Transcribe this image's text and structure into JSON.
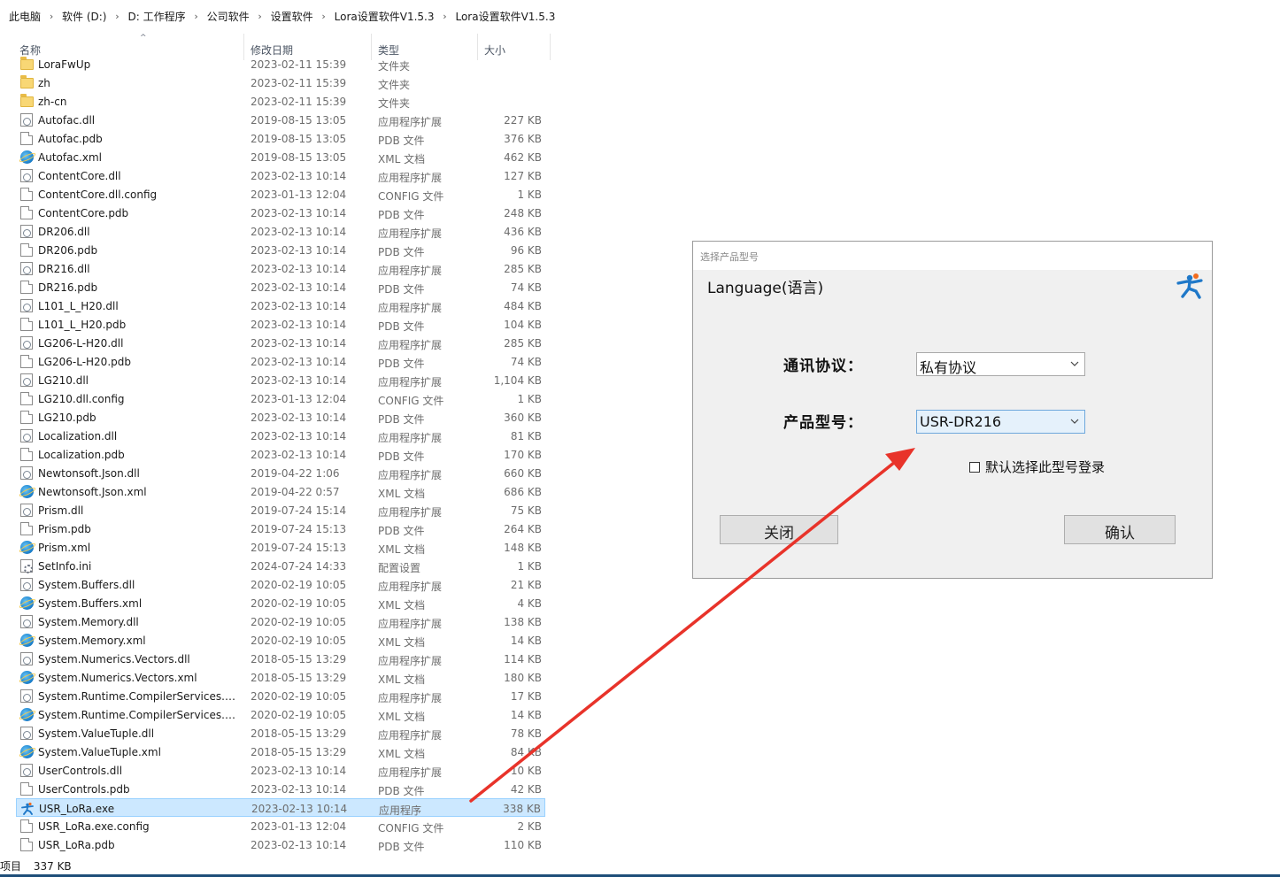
{
  "breadcrumb": [
    "此电脑",
    "软件 (D:)",
    "D:  工作程序",
    "公司软件",
    "设置软件",
    "Lora设置软件V1.5.3",
    "Lora设置软件V1.5.3"
  ],
  "columns": {
    "name": "名称",
    "date": "修改日期",
    "type": "类型",
    "size": "大小"
  },
  "files": [
    {
      "name": "LoraFwUp",
      "date": "2023-02-11 15:39",
      "type": "文件夹",
      "size": "",
      "icon": "folder-icon"
    },
    {
      "name": "zh",
      "date": "2023-02-11 15:39",
      "type": "文件夹",
      "size": "",
      "icon": "folder-icon"
    },
    {
      "name": "zh-cn",
      "date": "2023-02-11 15:39",
      "type": "文件夹",
      "size": "",
      "icon": "folder-icon"
    },
    {
      "name": "Autofac.dll",
      "date": "2019-08-15 13:05",
      "type": "应用程序扩展",
      "size": "227 KB",
      "icon": "dll-file-icon"
    },
    {
      "name": "Autofac.pdb",
      "date": "2019-08-15 13:05",
      "type": "PDB 文件",
      "size": "376 KB",
      "icon": "document-icon"
    },
    {
      "name": "Autofac.xml",
      "date": "2019-08-15 13:05",
      "type": "XML 文档",
      "size": "462 KB",
      "icon": "xml-file-icon"
    },
    {
      "name": "ContentCore.dll",
      "date": "2023-02-13 10:14",
      "type": "应用程序扩展",
      "size": "127 KB",
      "icon": "dll-file-icon"
    },
    {
      "name": "ContentCore.dll.config",
      "date": "2023-01-13 12:04",
      "type": "CONFIG 文件",
      "size": "1 KB",
      "icon": "document-icon"
    },
    {
      "name": "ContentCore.pdb",
      "date": "2023-02-13 10:14",
      "type": "PDB 文件",
      "size": "248 KB",
      "icon": "document-icon"
    },
    {
      "name": "DR206.dll",
      "date": "2023-02-13 10:14",
      "type": "应用程序扩展",
      "size": "436 KB",
      "icon": "dll-file-icon"
    },
    {
      "name": "DR206.pdb",
      "date": "2023-02-13 10:14",
      "type": "PDB 文件",
      "size": "96 KB",
      "icon": "document-icon"
    },
    {
      "name": "DR216.dll",
      "date": "2023-02-13 10:14",
      "type": "应用程序扩展",
      "size": "285 KB",
      "icon": "dll-file-icon"
    },
    {
      "name": "DR216.pdb",
      "date": "2023-02-13 10:14",
      "type": "PDB 文件",
      "size": "74 KB",
      "icon": "document-icon"
    },
    {
      "name": "L101_L_H20.dll",
      "date": "2023-02-13 10:14",
      "type": "应用程序扩展",
      "size": "484 KB",
      "icon": "dll-file-icon"
    },
    {
      "name": "L101_L_H20.pdb",
      "date": "2023-02-13 10:14",
      "type": "PDB 文件",
      "size": "104 KB",
      "icon": "document-icon"
    },
    {
      "name": "LG206-L-H20.dll",
      "date": "2023-02-13 10:14",
      "type": "应用程序扩展",
      "size": "285 KB",
      "icon": "dll-file-icon"
    },
    {
      "name": "LG206-L-H20.pdb",
      "date": "2023-02-13 10:14",
      "type": "PDB 文件",
      "size": "74 KB",
      "icon": "document-icon"
    },
    {
      "name": "LG210.dll",
      "date": "2023-02-13 10:14",
      "type": "应用程序扩展",
      "size": "1,104 KB",
      "icon": "dll-file-icon"
    },
    {
      "name": "LG210.dll.config",
      "date": "2023-01-13 12:04",
      "type": "CONFIG 文件",
      "size": "1 KB",
      "icon": "document-icon"
    },
    {
      "name": "LG210.pdb",
      "date": "2023-02-13 10:14",
      "type": "PDB 文件",
      "size": "360 KB",
      "icon": "document-icon"
    },
    {
      "name": "Localization.dll",
      "date": "2023-02-13 10:14",
      "type": "应用程序扩展",
      "size": "81 KB",
      "icon": "dll-file-icon"
    },
    {
      "name": "Localization.pdb",
      "date": "2023-02-13 10:14",
      "type": "PDB 文件",
      "size": "170 KB",
      "icon": "document-icon"
    },
    {
      "name": "Newtonsoft.Json.dll",
      "date": "2019-04-22 1:06",
      "type": "应用程序扩展",
      "size": "660 KB",
      "icon": "dll-file-icon"
    },
    {
      "name": "Newtonsoft.Json.xml",
      "date": "2019-04-22 0:57",
      "type": "XML 文档",
      "size": "686 KB",
      "icon": "xml-file-icon"
    },
    {
      "name": "Prism.dll",
      "date": "2019-07-24 15:14",
      "type": "应用程序扩展",
      "size": "75 KB",
      "icon": "dll-file-icon"
    },
    {
      "name": "Prism.pdb",
      "date": "2019-07-24 15:13",
      "type": "PDB 文件",
      "size": "264 KB",
      "icon": "document-icon"
    },
    {
      "name": "Prism.xml",
      "date": "2019-07-24 15:13",
      "type": "XML 文档",
      "size": "148 KB",
      "icon": "xml-file-icon"
    },
    {
      "name": "SetInfo.ini",
      "date": "2024-07-24 14:33",
      "type": "配置设置",
      "size": "1 KB",
      "icon": "ini-file-icon"
    },
    {
      "name": "System.Buffers.dll",
      "date": "2020-02-19 10:05",
      "type": "应用程序扩展",
      "size": "21 KB",
      "icon": "dll-file-icon"
    },
    {
      "name": "System.Buffers.xml",
      "date": "2020-02-19 10:05",
      "type": "XML 文档",
      "size": "4 KB",
      "icon": "xml-file-icon"
    },
    {
      "name": "System.Memory.dll",
      "date": "2020-02-19 10:05",
      "type": "应用程序扩展",
      "size": "138 KB",
      "icon": "dll-file-icon"
    },
    {
      "name": "System.Memory.xml",
      "date": "2020-02-19 10:05",
      "type": "XML 文档",
      "size": "14 KB",
      "icon": "xml-file-icon"
    },
    {
      "name": "System.Numerics.Vectors.dll",
      "date": "2018-05-15 13:29",
      "type": "应用程序扩展",
      "size": "114 KB",
      "icon": "dll-file-icon"
    },
    {
      "name": "System.Numerics.Vectors.xml",
      "date": "2018-05-15 13:29",
      "type": "XML 文档",
      "size": "180 KB",
      "icon": "xml-file-icon"
    },
    {
      "name": "System.Runtime.CompilerServices.Un...",
      "date": "2020-02-19 10:05",
      "type": "应用程序扩展",
      "size": "17 KB",
      "icon": "dll-file-icon"
    },
    {
      "name": "System.Runtime.CompilerServices.Un...",
      "date": "2020-02-19 10:05",
      "type": "XML 文档",
      "size": "14 KB",
      "icon": "xml-file-icon"
    },
    {
      "name": "System.ValueTuple.dll",
      "date": "2018-05-15 13:29",
      "type": "应用程序扩展",
      "size": "78 KB",
      "icon": "dll-file-icon"
    },
    {
      "name": "System.ValueTuple.xml",
      "date": "2018-05-15 13:29",
      "type": "XML 文档",
      "size": "84 KB",
      "icon": "xml-file-icon"
    },
    {
      "name": "UserControls.dll",
      "date": "2023-02-13 10:14",
      "type": "应用程序扩展",
      "size": "10 KB",
      "icon": "dll-file-icon"
    },
    {
      "name": "UserControls.pdb",
      "date": "2023-02-13 10:14",
      "type": "PDB 文件",
      "size": "42 KB",
      "icon": "document-icon"
    },
    {
      "name": "USR_LoRa.exe",
      "date": "2023-02-13 10:14",
      "type": "应用程序",
      "size": "338 KB",
      "icon": "exe-app-icon",
      "selected": true
    },
    {
      "name": "USR_LoRa.exe.config",
      "date": "2023-01-13 12:04",
      "type": "CONFIG 文件",
      "size": "2 KB",
      "icon": "document-icon"
    },
    {
      "name": "USR_LoRa.pdb",
      "date": "2023-02-13 10:14",
      "type": "PDB 文件",
      "size": "110 KB",
      "icon": "document-icon"
    }
  ],
  "status": {
    "items": "项目",
    "selected_size": "337 KB"
  },
  "dialog": {
    "title": "选择产品型号",
    "language_label": "Language(语言)",
    "protocol_label": "通讯协议：",
    "protocol_value": "私有协议",
    "model_label": "产品型号：",
    "model_value": "USR-DR216",
    "remember_label": "默认选择此型号登录",
    "remember_checked": false,
    "close_label": "关闭",
    "confirm_label": "确认",
    "logo_icon": "running-man-logo-icon"
  },
  "colors": {
    "selection": "#cce8ff",
    "arrow": "#e8332a",
    "logo": "#1f78c8",
    "logo_accent": "#f26b1d"
  }
}
